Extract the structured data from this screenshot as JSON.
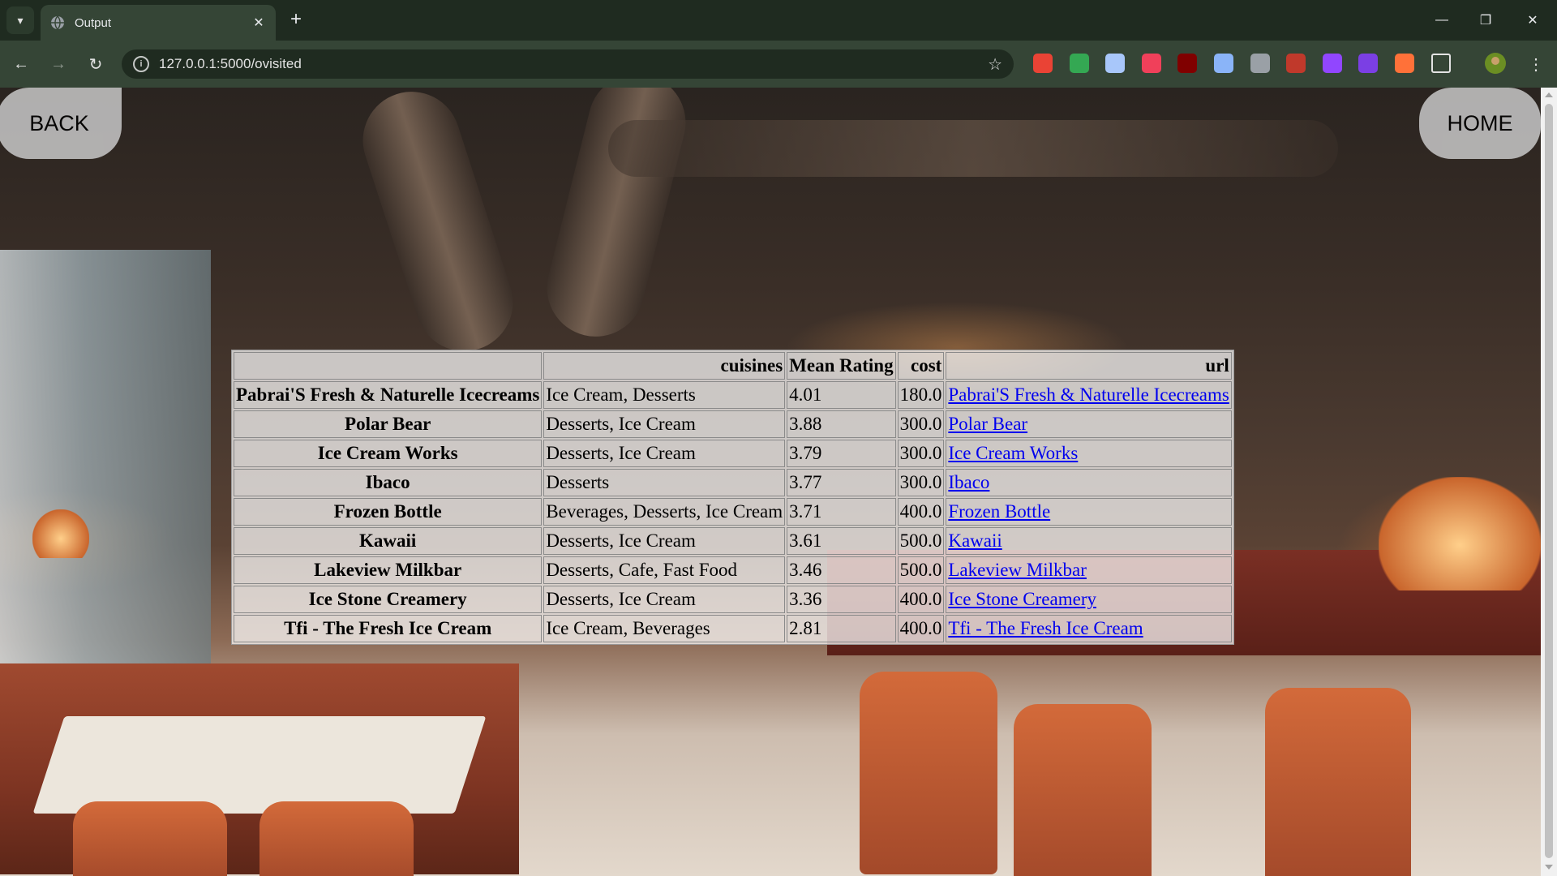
{
  "browser": {
    "tab_title": "Output",
    "url": "127.0.0.1:5000/ovisited",
    "new_tab_glyph": "+",
    "close_glyph": "✕"
  },
  "page": {
    "back_label": "BACK",
    "home_label": "HOME"
  },
  "table": {
    "headers": [
      "",
      "cuisines",
      "Mean Rating",
      "cost",
      "url"
    ],
    "rows": [
      {
        "name": "Pabrai'S Fresh & Naturelle Icecreams",
        "cuisines": "Ice Cream, Desserts",
        "rating": "4.01",
        "cost": "180.0",
        "url": "Pabrai'S Fresh & Naturelle Icecreams"
      },
      {
        "name": "Polar Bear",
        "cuisines": "Desserts, Ice Cream",
        "rating": "3.88",
        "cost": "300.0",
        "url": "Polar Bear"
      },
      {
        "name": "Ice Cream Works",
        "cuisines": "Desserts, Ice Cream",
        "rating": "3.79",
        "cost": "300.0",
        "url": "Ice Cream Works"
      },
      {
        "name": "Ibaco",
        "cuisines": "Desserts",
        "rating": "3.77",
        "cost": "300.0",
        "url": "Ibaco"
      },
      {
        "name": "Frozen Bottle",
        "cuisines": "Beverages, Desserts, Ice Cream",
        "rating": "3.71",
        "cost": "400.0",
        "url": "Frozen Bottle"
      },
      {
        "name": "Kawaii",
        "cuisines": "Desserts, Ice Cream",
        "rating": "3.61",
        "cost": "500.0",
        "url": "Kawaii"
      },
      {
        "name": "Lakeview Milkbar",
        "cuisines": "Desserts, Cafe, Fast Food",
        "rating": "3.46",
        "cost": "500.0",
        "url": "Lakeview Milkbar"
      },
      {
        "name": "Ice Stone Creamery",
        "cuisines": "Desserts, Ice Cream",
        "rating": "3.36",
        "cost": "400.0",
        "url": "Ice Stone Creamery"
      },
      {
        "name": "Tfi - The Fresh Ice Cream",
        "cuisines": "Ice Cream, Beverages",
        "rating": "2.81",
        "cost": "400.0",
        "url": "Tfi - The Fresh Ice Cream"
      }
    ]
  },
  "extensions": [
    {
      "name": "red-circle-extension-icon",
      "color": "#ea4335"
    },
    {
      "name": "green-lock-extension-icon",
      "color": "#34a853"
    },
    {
      "name": "mail-check-extension-icon",
      "color": "#a8c7fa"
    },
    {
      "name": "red-grid-extension-icon",
      "color": "#f0405a"
    },
    {
      "name": "ublock-extension-icon",
      "color": "#800000"
    },
    {
      "name": "camera-extension-icon",
      "color": "#8ab4f8"
    },
    {
      "name": "pen-extension-icon",
      "color": "#9aa0a6"
    },
    {
      "name": "shield-extension-icon",
      "color": "#c0392b"
    },
    {
      "name": "twitch-extension-icon",
      "color": "#9146ff"
    },
    {
      "name": "p-badge-extension-icon",
      "color": "#7b3fe4"
    },
    {
      "name": "orange-fox-extension-icon",
      "color": "#ff7139"
    },
    {
      "name": "puzzle-extensions-icon",
      "color": "#e3e3e3"
    }
  ]
}
